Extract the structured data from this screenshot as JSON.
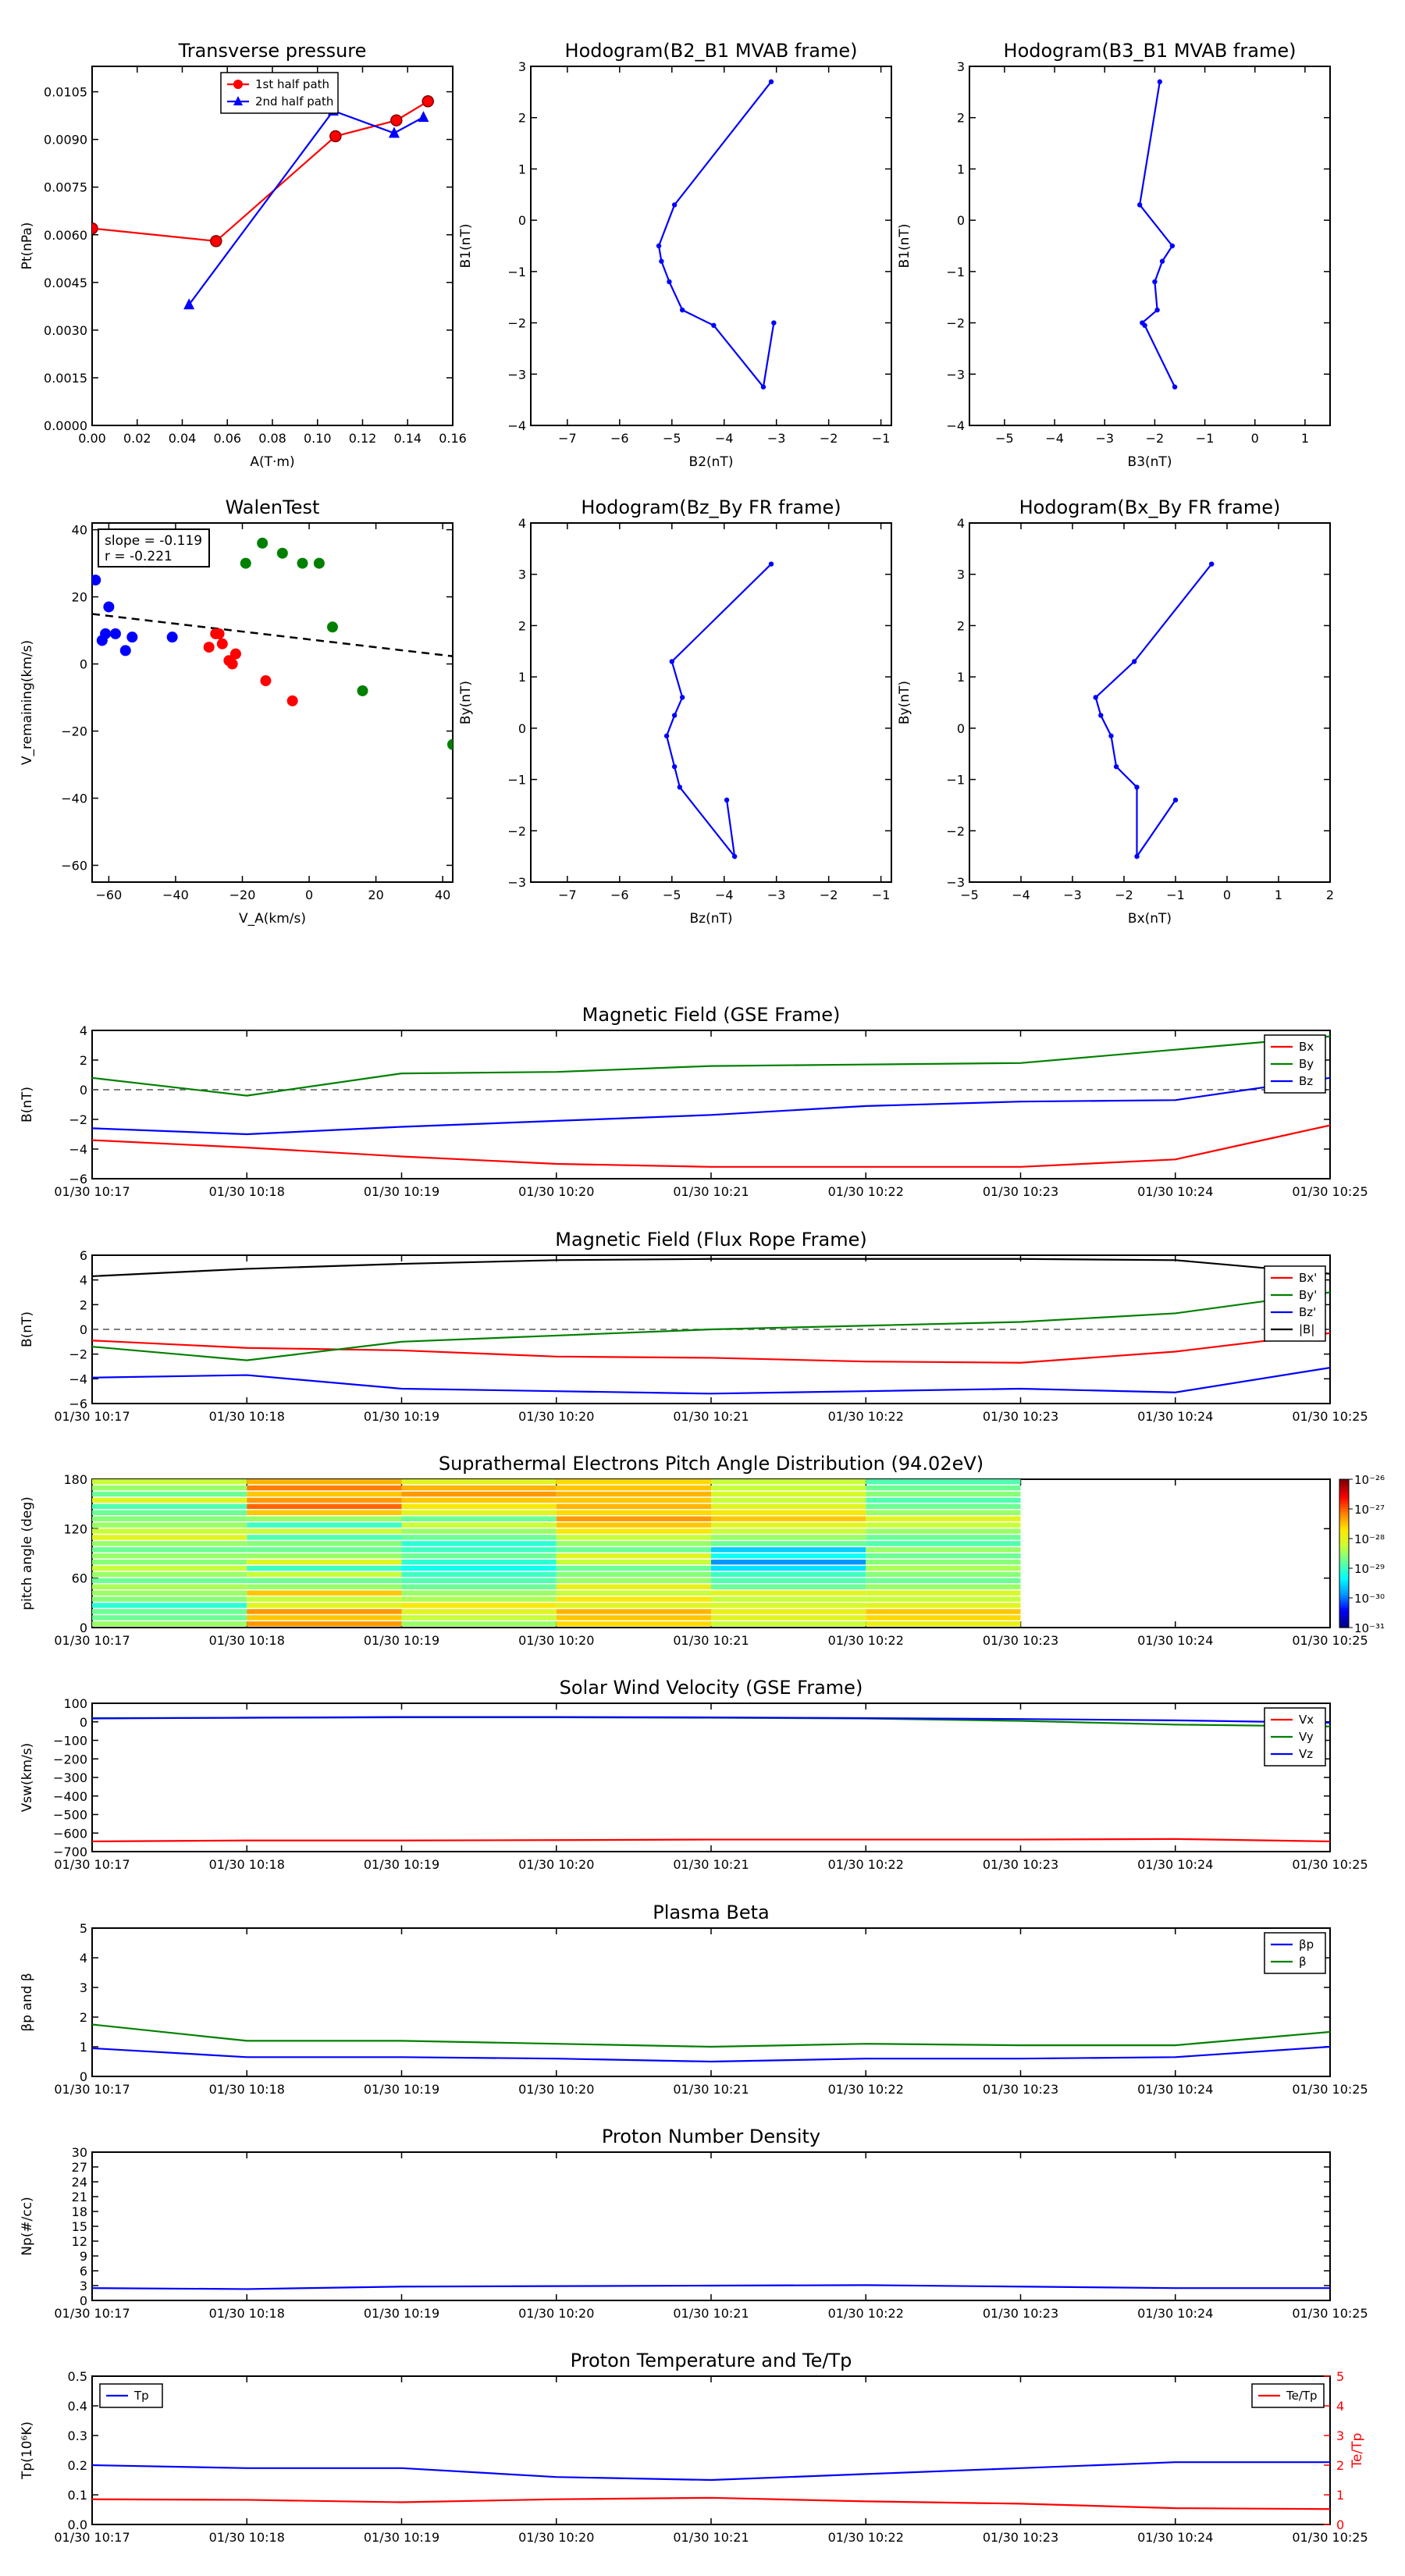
{
  "time_ticks": [
    "01/30 10:17",
    "01/30 10:18",
    "01/30 10:19",
    "01/30 10:20",
    "01/30 10:21",
    "01/30 10:22",
    "01/30 10:23",
    "01/30 10:24",
    "01/30 10:25"
  ],
  "chart_data": [
    {
      "id": "transverse-pressure",
      "type": "line",
      "title": "Transverse pressure",
      "xlabel": "A(T·m)",
      "ylabel": "Pt(nPa)",
      "xlim": [
        0,
        0.16
      ],
      "ylim": [
        0,
        0.0113
      ],
      "xticks": [
        0,
        0.02,
        0.04,
        0.06,
        0.08,
        0.1,
        0.12,
        0.14,
        0.16
      ],
      "xtick_labels": [
        "0.00",
        "0.02",
        "0.04",
        "0.06",
        "0.08",
        "0.10",
        "0.12",
        "0.14",
        "0.16"
      ],
      "yticks": [
        0,
        0.0015,
        0.003,
        0.0045,
        0.006,
        0.0075,
        0.009,
        0.0105
      ],
      "ytick_labels": [
        "0.0000",
        "0.0015",
        "0.0030",
        "0.0045",
        "0.0060",
        "0.0075",
        "0.0090",
        "0.0105"
      ],
      "legend_position": "top-center",
      "series": [
        {
          "name": "1st half path",
          "color": "#ff0000",
          "marker": "circle",
          "x": [
            0.0,
            0.055,
            0.108,
            0.135,
            0.149
          ],
          "y": [
            0.0062,
            0.0058,
            0.0091,
            0.0096,
            0.0102
          ]
        },
        {
          "name": "2nd half path",
          "color": "#0000ff",
          "marker": "triangle",
          "x": [
            0.043,
            0.107,
            0.134,
            0.147
          ],
          "y": [
            0.0038,
            0.0099,
            0.0092,
            0.0097
          ]
        }
      ]
    },
    {
      "id": "hodogram-b2-b1",
      "type": "line",
      "title": "Hodogram(B2_B1 MVAB frame)",
      "xlabel": "B2(nT)",
      "ylabel": "B1(nT)",
      "xlim": [
        -7.7,
        -0.8
      ],
      "ylim": [
        -4,
        3
      ],
      "xticks": [
        -7,
        -6,
        -5,
        -4,
        -3,
        -2,
        -1
      ],
      "yticks": [
        -4,
        -3,
        -2,
        -1,
        0,
        1,
        2,
        3
      ],
      "series": [
        {
          "color": "#0000ff",
          "x": [
            -3.1,
            -4.95,
            -5.25,
            -5.2,
            -5.05,
            -4.8,
            -4.2,
            -3.25,
            -3.05
          ],
          "y": [
            2.7,
            0.3,
            -0.5,
            -0.8,
            -1.2,
            -1.75,
            -2.05,
            -3.25,
            -2.0
          ]
        }
      ]
    },
    {
      "id": "hodogram-b3-b1",
      "type": "line",
      "title": "Hodogram(B3_B1 MVAB frame)",
      "xlabel": "B3(nT)",
      "ylabel": "B1(nT)",
      "xlim": [
        -5.7,
        1.5
      ],
      "ylim": [
        -4,
        3
      ],
      "xticks": [
        -5,
        -4,
        -3,
        -2,
        -1,
        0,
        1
      ],
      "yticks": [
        -4,
        -3,
        -2,
        -1,
        0,
        1,
        2,
        3
      ],
      "series": [
        {
          "color": "#0000ff",
          "x": [
            -1.9,
            -2.3,
            -1.65,
            -1.85,
            -2.0,
            -1.95,
            -2.25,
            -2.2,
            -1.6
          ],
          "y": [
            2.7,
            0.3,
            -0.5,
            -0.8,
            -1.2,
            -1.75,
            -2.0,
            -2.05,
            -3.25
          ]
        }
      ]
    },
    {
      "id": "walen-test",
      "type": "scatter",
      "title": "WalenTest",
      "xlabel": "V_A(km/s)",
      "ylabel": "V_remaining(km/s)",
      "xlim": [
        -65,
        43
      ],
      "ylim": [
        -65,
        42
      ],
      "xticks": [
        -60,
        -40,
        -20,
        0,
        20,
        40
      ],
      "yticks": [
        -60,
        -40,
        -20,
        0,
        20,
        40
      ],
      "annotation": [
        "slope = -0.119",
        "r = -0.221"
      ],
      "fit_line": {
        "x": [
          -65,
          43
        ],
        "y": [
          14.9,
          2.3
        ],
        "color": "#000000",
        "style": "dashed"
      },
      "series": [
        {
          "color": "#0000ff",
          "x": [
            -64,
            -62,
            -61,
            -60,
            -58,
            -55,
            -53,
            -41
          ],
          "y": [
            25,
            7,
            9,
            17,
            9,
            4,
            8,
            8
          ]
        },
        {
          "color": "#ff0000",
          "x": [
            -30,
            -28,
            -27,
            -26,
            -24,
            -23,
            -22,
            -13,
            -5
          ],
          "y": [
            5,
            9,
            9,
            6,
            1,
            0,
            3,
            -5,
            -11
          ]
        },
        {
          "color": "#008000",
          "x": [
            -19,
            -14,
            -8,
            -2,
            3,
            7,
            16,
            43
          ],
          "y": [
            30,
            36,
            33,
            30,
            30,
            11,
            -8,
            -24
          ]
        }
      ]
    },
    {
      "id": "hodogram-bz-by",
      "type": "line",
      "title": "Hodogram(Bz_By FR frame)",
      "xlabel": "Bz(nT)",
      "ylabel": "By(nT)",
      "xlim": [
        -7.7,
        -0.8
      ],
      "ylim": [
        -3,
        4
      ],
      "xticks": [
        -7,
        -6,
        -5,
        -4,
        -3,
        -2,
        -1
      ],
      "yticks": [
        -3,
        -2,
        -1,
        0,
        1,
        2,
        3,
        4
      ],
      "series": [
        {
          "color": "#0000ff",
          "x": [
            -3.1,
            -5.0,
            -4.8,
            -4.95,
            -5.1,
            -4.95,
            -4.85,
            -3.8,
            -3.95
          ],
          "y": [
            3.2,
            1.3,
            0.6,
            0.25,
            -0.15,
            -0.75,
            -1.15,
            -2.5,
            -1.4
          ]
        }
      ]
    },
    {
      "id": "hodogram-bx-by",
      "type": "line",
      "title": "Hodogram(Bx_By FR frame)",
      "xlabel": "Bx(nT)",
      "ylabel": "By(nT)",
      "xlim": [
        -5,
        2
      ],
      "ylim": [
        -3,
        4
      ],
      "xticks": [
        -5,
        -4,
        -3,
        -2,
        -1,
        0,
        1,
        2
      ],
      "yticks": [
        -3,
        -2,
        -1,
        0,
        1,
        2,
        3,
        4
      ],
      "series": [
        {
          "color": "#0000ff",
          "x": [
            -0.3,
            -1.8,
            -2.55,
            -2.45,
            -2.25,
            -2.15,
            -1.75,
            -1.75,
            -1.0
          ],
          "y": [
            3.2,
            1.3,
            0.6,
            0.25,
            -0.15,
            -0.75,
            -1.15,
            -2.5,
            -1.4
          ]
        }
      ]
    },
    {
      "id": "magnetic-field-gse",
      "type": "line",
      "title": "Magnetic Field (GSE Frame)",
      "xlabel": "",
      "ylabel": "B(nT)",
      "ylim": [
        -6,
        4
      ],
      "yticks": [
        -6,
        -4,
        -2,
        0,
        2,
        4
      ],
      "zero_line": true,
      "legend_position": "top-right",
      "series": [
        {
          "name": "Bx",
          "color": "#ff0000",
          "values": [
            -3.4,
            -3.9,
            -4.5,
            -5.0,
            -5.2,
            -5.2,
            -5.2,
            -4.7,
            -2.4
          ]
        },
        {
          "name": "By",
          "color": "#008000",
          "values": [
            0.8,
            -0.4,
            1.1,
            1.2,
            1.6,
            1.7,
            1.8,
            2.7,
            3.6
          ]
        },
        {
          "name": "Bz",
          "color": "#0000ff",
          "values": [
            -2.6,
            -3.0,
            -2.5,
            -2.1,
            -1.7,
            -1.1,
            -0.8,
            -0.7,
            0.8
          ]
        }
      ]
    },
    {
      "id": "magnetic-field-fr",
      "type": "line",
      "title": "Magnetic Field (Flux Rope Frame)",
      "xlabel": "",
      "ylabel": "B(nT)",
      "ylim": [
        -6,
        6
      ],
      "yticks": [
        -6,
        -4,
        -2,
        0,
        2,
        4,
        6
      ],
      "zero_line": true,
      "legend_position": "right",
      "series": [
        {
          "name": "Bx'",
          "color": "#ff0000",
          "values": [
            -0.9,
            -1.5,
            -1.7,
            -2.2,
            -2.3,
            -2.6,
            -2.7,
            -1.8,
            -0.3
          ]
        },
        {
          "name": "By'",
          "color": "#008000",
          "values": [
            -1.4,
            -2.5,
            -1.0,
            -0.5,
            0.0,
            0.3,
            0.6,
            1.3,
            3.0
          ]
        },
        {
          "name": "Bz'",
          "color": "#0000ff",
          "values": [
            -3.9,
            -3.7,
            -4.8,
            -5.0,
            -5.2,
            -5.0,
            -4.8,
            -5.1,
            -3.1
          ]
        },
        {
          "name": "|B|",
          "color": "#000000",
          "values": [
            4.3,
            4.9,
            5.3,
            5.6,
            5.7,
            5.7,
            5.7,
            5.6,
            4.5
          ]
        }
      ]
    },
    {
      "id": "pitch-angle",
      "type": "heatmap",
      "title": "Suprathermal Electrons Pitch Angle Distribution (94.02eV)",
      "xlabel": "",
      "ylabel": "pitch angle (deg)",
      "ylim": [
        0,
        180
      ],
      "yticks": [
        0,
        60,
        120,
        180
      ],
      "colorbar_ticks": [
        "10⁻²⁶",
        "10⁻²⁷",
        "10⁻²⁸",
        "10⁻²⁹",
        "10⁻³⁰",
        "10⁻³¹"
      ],
      "time_columns": 6,
      "bin_count": 24,
      "levels": [
        [
          0.5,
          0.45,
          0.45,
          0.38,
          0.48,
          0.5,
          0.52,
          0.45,
          0.5,
          0.55,
          0.48,
          0.5,
          0.45,
          0.5,
          0.6,
          0.55,
          0.5,
          0.48,
          0.45,
          0.42,
          0.6,
          0.45,
          0.5,
          0.55
        ],
        [
          0.75,
          0.7,
          0.75,
          0.6,
          0.55,
          0.7,
          0.5,
          0.45,
          0.55,
          0.4,
          0.6,
          0.5,
          0.45,
          0.48,
          0.42,
          0.55,
          0.4,
          0.5,
          0.7,
          0.8,
          0.75,
          0.7,
          0.78,
          0.72
        ],
        [
          0.5,
          0.55,
          0.6,
          0.65,
          0.52,
          0.5,
          0.45,
          0.42,
          0.4,
          0.35,
          0.38,
          0.45,
          0.4,
          0.38,
          0.45,
          0.5,
          0.55,
          0.45,
          0.6,
          0.65,
          0.7,
          0.75,
          0.72,
          0.6
        ],
        [
          0.68,
          0.7,
          0.72,
          0.6,
          0.65,
          0.55,
          0.62,
          0.5,
          0.48,
          0.45,
          0.55,
          0.6,
          0.45,
          0.5,
          0.55,
          0.65,
          0.7,
          0.75,
          0.68,
          0.72,
          0.7,
          0.72,
          0.7,
          0.68
        ],
        [
          0.55,
          0.6,
          0.62,
          0.58,
          0.55,
          0.6,
          0.45,
          0.42,
          0.4,
          0.3,
          0.22,
          0.35,
          0.28,
          0.45,
          0.5,
          0.55,
          0.6,
          0.7,
          0.65,
          0.6,
          0.55,
          0.58,
          0.55,
          0.55
        ],
        [
          0.62,
          0.68,
          0.7,
          0.6,
          0.55,
          0.58,
          0.5,
          0.45,
          0.48,
          0.52,
          0.48,
          0.45,
          0.5,
          0.42,
          0.45,
          0.5,
          0.55,
          0.6,
          0.5,
          0.45,
          0.42,
          0.48,
          0.45,
          0.42
        ]
      ]
    },
    {
      "id": "solar-wind-velocity",
      "type": "line",
      "title": "Solar Wind Velocity (GSE Frame)",
      "xlabel": "",
      "ylabel": "Vsw(km/s)",
      "ylim": [
        -700,
        100
      ],
      "yticks": [
        -700,
        -600,
        -500,
        -400,
        -300,
        -200,
        -100,
        0,
        100
      ],
      "legend_position": "top-right",
      "series": [
        {
          "name": "Vx",
          "color": "#ff0000",
          "values": [
            -645,
            -640,
            -640,
            -638,
            -635,
            -635,
            -635,
            -632,
            -645
          ]
        },
        {
          "name": "Vy",
          "color": "#008000",
          "values": [
            20,
            22,
            24,
            24,
            22,
            18,
            5,
            -15,
            -25
          ]
        },
        {
          "name": "Vz",
          "color": "#0000ff",
          "values": [
            18,
            22,
            26,
            26,
            24,
            20,
            15,
            8,
            -5
          ]
        }
      ]
    },
    {
      "id": "plasma-beta",
      "type": "line",
      "title": "Plasma Beta",
      "xlabel": "",
      "ylabel": "βp and β",
      "ylim": [
        0,
        5
      ],
      "yticks": [
        0,
        1,
        2,
        3,
        4,
        5
      ],
      "legend_position": "top-right",
      "series": [
        {
          "name": "βp",
          "color": "#0000ff",
          "values": [
            0.95,
            0.65,
            0.65,
            0.6,
            0.5,
            0.6,
            0.6,
            0.65,
            1.0
          ]
        },
        {
          "name": "β",
          "color": "#008000",
          "values": [
            1.75,
            1.2,
            1.2,
            1.1,
            1.0,
            1.1,
            1.05,
            1.05,
            1.5
          ]
        }
      ]
    },
    {
      "id": "proton-density",
      "type": "line",
      "title": "Proton Number Density",
      "xlabel": "",
      "ylabel": "Np(#/cc)",
      "ylim": [
        0,
        30
      ],
      "yticks": [
        0,
        3,
        6,
        9,
        12,
        15,
        18,
        21,
        24,
        27,
        30
      ],
      "series": [
        {
          "color": "#0000ff",
          "values": [
            2.5,
            2.3,
            2.8,
            2.9,
            3.0,
            3.1,
            2.8,
            2.5,
            2.5
          ]
        }
      ]
    },
    {
      "id": "proton-temperature",
      "type": "line",
      "title": "Proton Temperature and Te/Tp",
      "xlabel": "",
      "ylabel": "Tp(10⁶K)",
      "ylabel_right": "Te/Tp",
      "ylim": [
        0,
        0.5
      ],
      "yticks": [
        0,
        0.1,
        0.2,
        0.3,
        0.4,
        0.5
      ],
      "ytick_labels": [
        "0.0",
        "0.1",
        "0.2",
        "0.3",
        "0.4",
        "0.5"
      ],
      "ylim_right": [
        0,
        5
      ],
      "yticks_right": [
        0,
        1,
        2,
        3,
        4,
        5
      ],
      "legend_left": "top-left",
      "legend_right": "top-right",
      "series": [
        {
          "name": "Tp",
          "color": "#0000ff",
          "axis": "left",
          "values": [
            0.2,
            0.19,
            0.19,
            0.16,
            0.15,
            0.17,
            0.19,
            0.21,
            0.21
          ]
        },
        {
          "name": "Te/Tp",
          "color": "#ff0000",
          "axis": "right",
          "values": [
            0.85,
            0.83,
            0.75,
            0.85,
            0.9,
            0.78,
            0.7,
            0.55,
            0.52
          ]
        }
      ]
    }
  ]
}
